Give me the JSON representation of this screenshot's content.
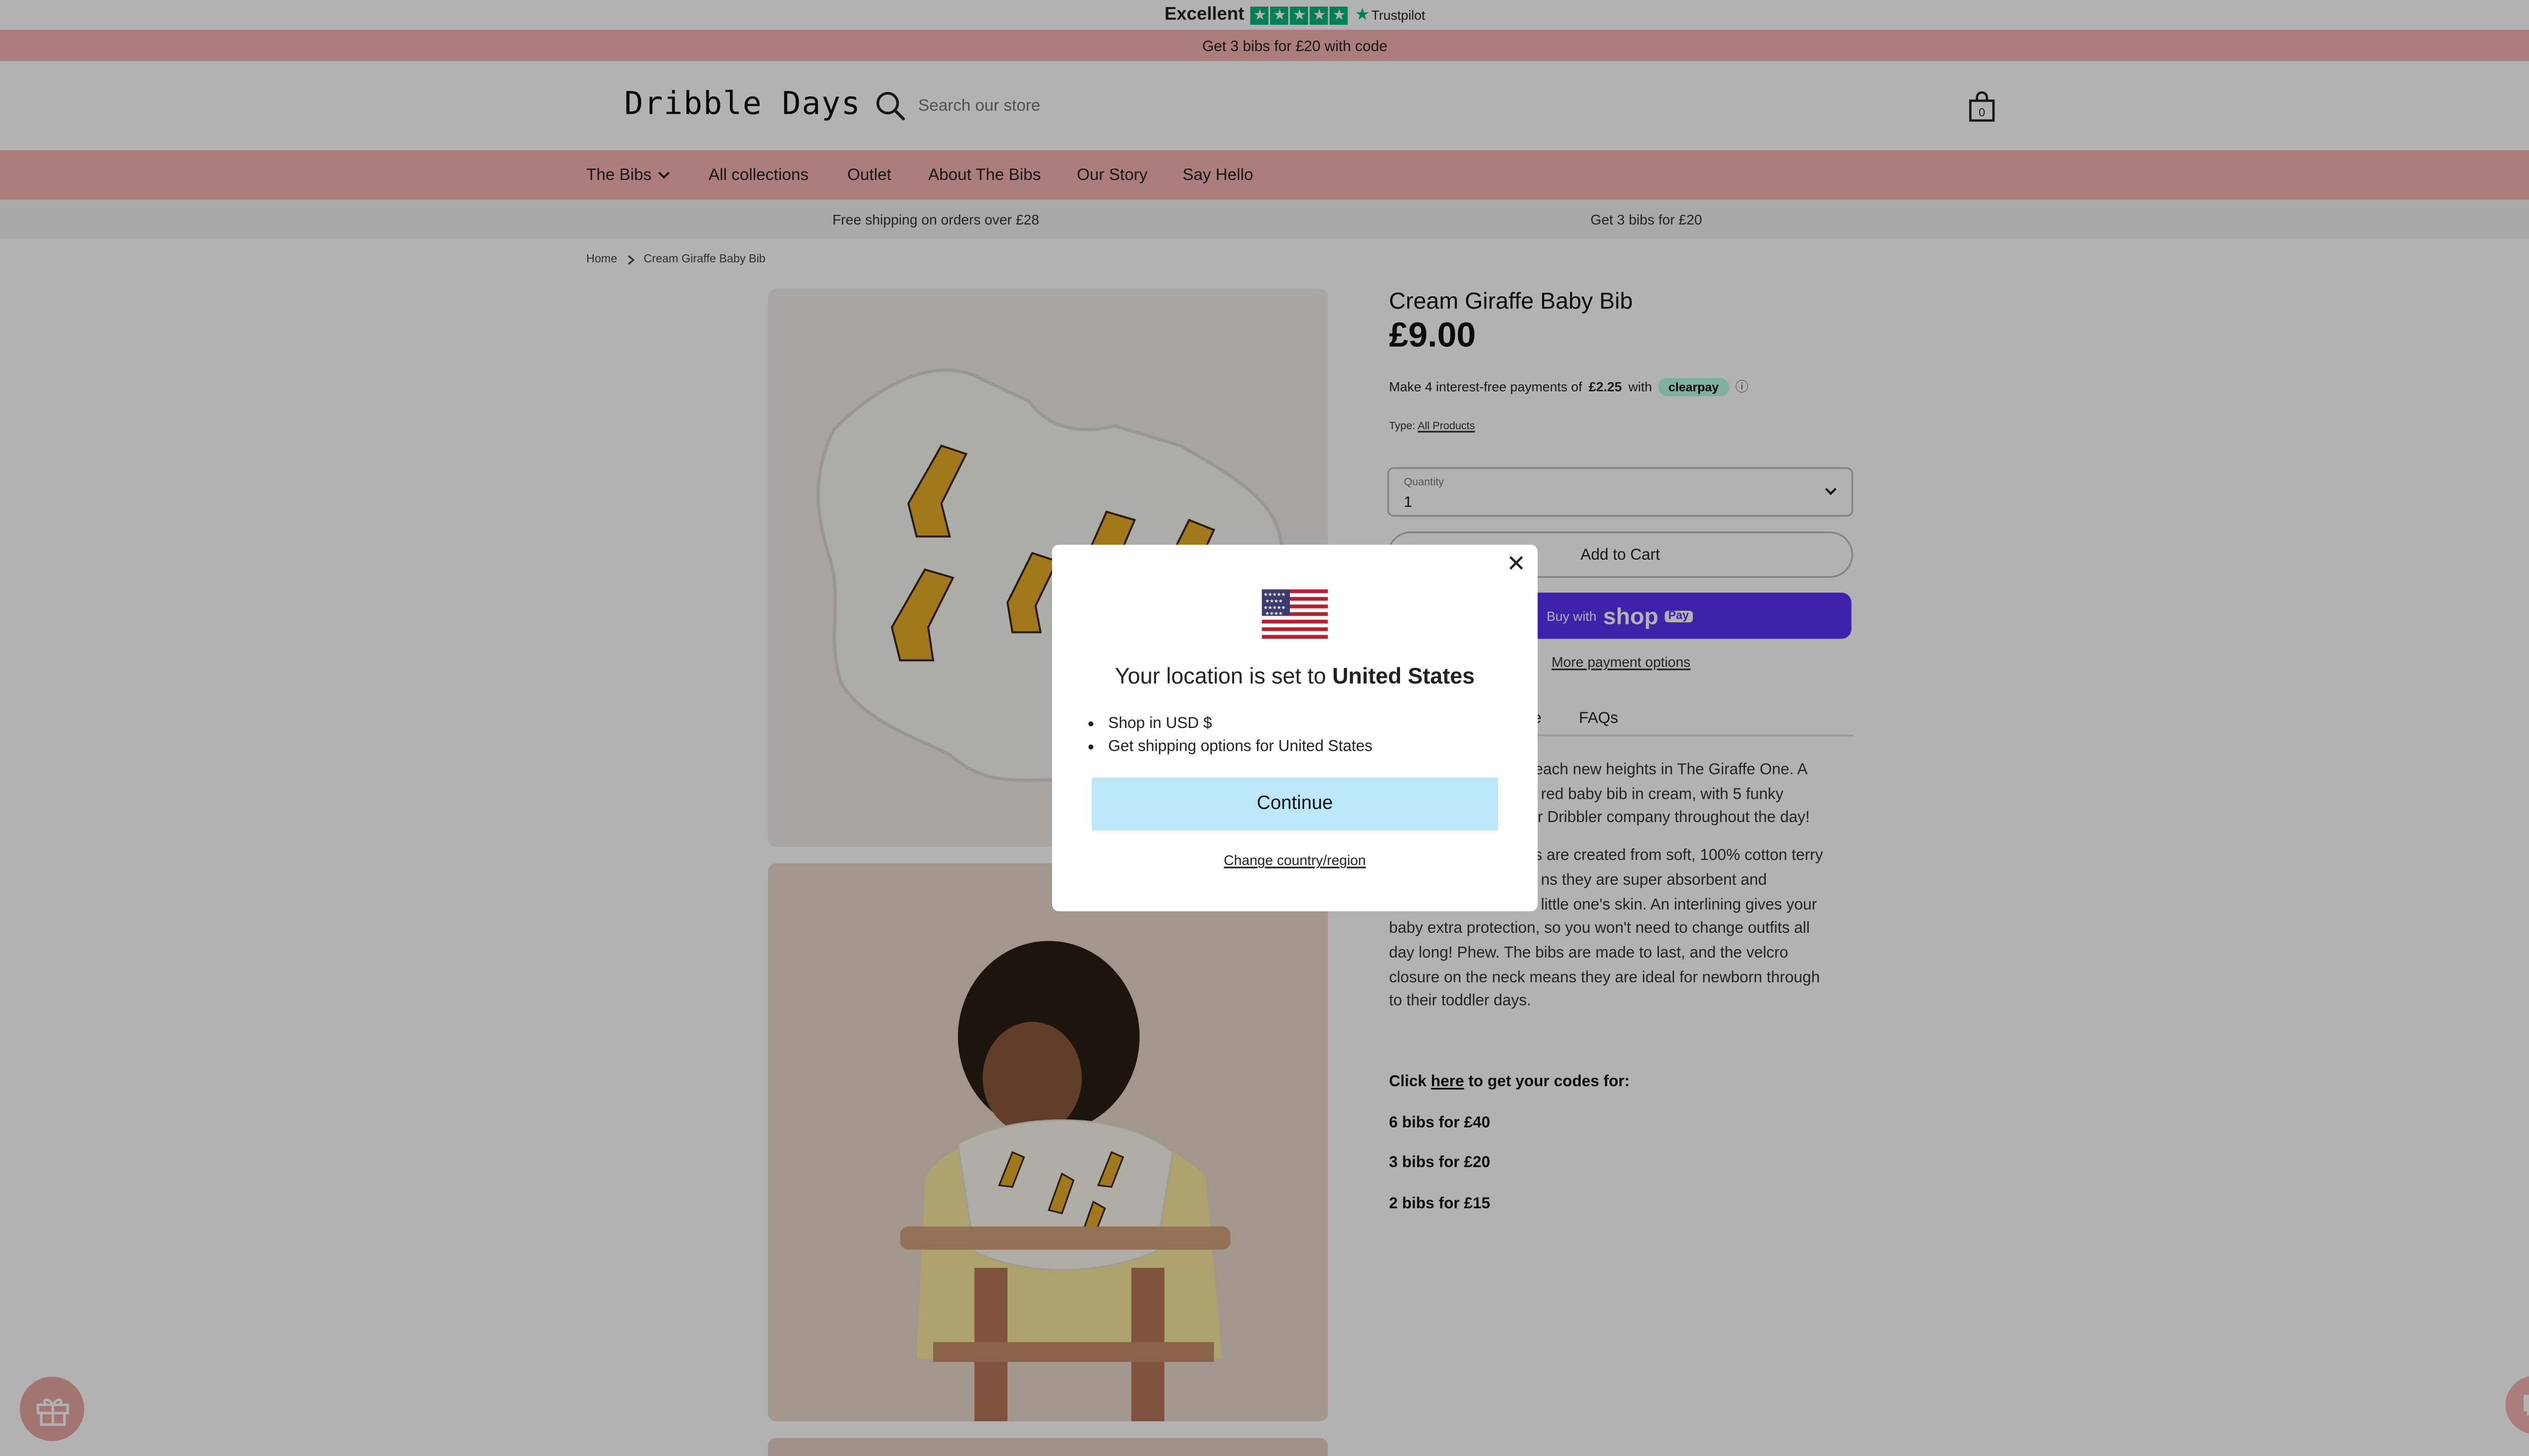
{
  "trustpilot": {
    "rating_text": "Excellent",
    "brand": "Trustpilot"
  },
  "promo_bar": {
    "text": "Get 3 bibs for £20 with code"
  },
  "header": {
    "logo": "Dribble Days",
    "search_placeholder": "Search our store",
    "cart_count": "0"
  },
  "nav": {
    "items": [
      {
        "label": "The Bibs",
        "has_dropdown": true
      },
      {
        "label": "All collections"
      },
      {
        "label": "Outlet"
      },
      {
        "label": "About The Bibs"
      },
      {
        "label": "Our Story"
      },
      {
        "label": "Say Hello"
      }
    ]
  },
  "info_bar": {
    "left": "Free shipping on orders over £28",
    "right": "Get 3 bibs for £20"
  },
  "breadcrumb": {
    "home": "Home",
    "current": "Cream Giraffe Baby Bib"
  },
  "product": {
    "title": "Cream Giraffe Baby Bib",
    "price": "£9.00",
    "clearpay_prefix": "Make 4 interest-free payments of",
    "clearpay_amount": "£2.25",
    "clearpay_with": "with",
    "clearpay_brand": "clearpay",
    "type_label": "Type:",
    "type_value": "All Products",
    "quantity_label": "Quantity",
    "quantity_value": "1",
    "add_to_cart": "Add to Cart",
    "buy_with": "Buy with",
    "shop_word": "shop",
    "pay_word": "Pay",
    "more_payment": "More payment options",
    "tabs": [
      "e",
      "FAQs"
    ],
    "desc_p1_a": "each new heights in The Giraffe One. A",
    "desc_p1_b": "red baby bib in cream, with 5 funky",
    "desc_p1_c": "r Dribbler company throughout the day!",
    "desc_p2_a": "s are created from soft, 100% cotton terry",
    "desc_p2_b": "ns they are super absorbent and",
    "desc_p2_c": "little one's skin. An interlining gives your",
    "desc_p2_d": "baby extra protection, so you won't need to change outfits all",
    "desc_p2_e": "day long! Phew. The bibs are made to last, and the velcro",
    "desc_p2_f": "closure on the neck means they are ideal for newborn through",
    "desc_p2_g": "to their toddler days.",
    "codes_prefix": "Click",
    "codes_link": "here",
    "codes_suffix": "to get your codes for:",
    "codes": [
      "6 bibs for £40",
      "3 bibs for £20",
      "2 bibs for £15"
    ]
  },
  "modal": {
    "heading_prefix": "Your location is set to",
    "country": "United States",
    "bullets": [
      "Shop in USD $",
      "Get shipping options for United States"
    ],
    "continue": "Continue",
    "change": "Change country/region"
  },
  "colors": {
    "pink": "#f6b4b4",
    "shop_pay": "#5a31f4",
    "continue_bg": "#bde7fb",
    "trustpilot_green": "#00b67a"
  }
}
